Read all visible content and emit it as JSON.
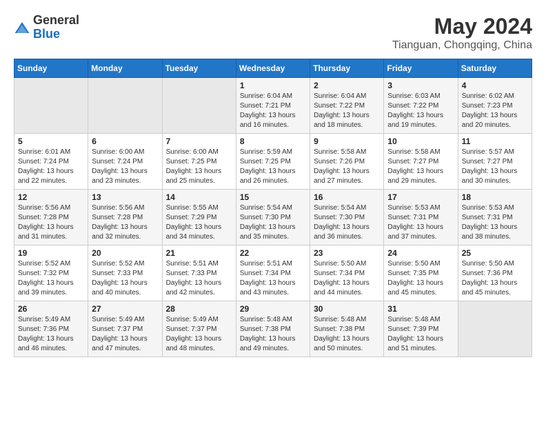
{
  "logo": {
    "general": "General",
    "blue": "Blue"
  },
  "header": {
    "title": "May 2024",
    "subtitle": "Tianguan, Chongqing, China"
  },
  "weekdays": [
    "Sunday",
    "Monday",
    "Tuesday",
    "Wednesday",
    "Thursday",
    "Friday",
    "Saturday"
  ],
  "weeks": [
    [
      {
        "day": "",
        "empty": true
      },
      {
        "day": "",
        "empty": true
      },
      {
        "day": "",
        "empty": true
      },
      {
        "day": "1",
        "sunrise": "6:04 AM",
        "sunset": "7:21 PM",
        "daylight": "13 hours and 16 minutes."
      },
      {
        "day": "2",
        "sunrise": "6:04 AM",
        "sunset": "7:22 PM",
        "daylight": "13 hours and 18 minutes."
      },
      {
        "day": "3",
        "sunrise": "6:03 AM",
        "sunset": "7:22 PM",
        "daylight": "13 hours and 19 minutes."
      },
      {
        "day": "4",
        "sunrise": "6:02 AM",
        "sunset": "7:23 PM",
        "daylight": "13 hours and 20 minutes."
      }
    ],
    [
      {
        "day": "5",
        "sunrise": "6:01 AM",
        "sunset": "7:24 PM",
        "daylight": "13 hours and 22 minutes."
      },
      {
        "day": "6",
        "sunrise": "6:00 AM",
        "sunset": "7:24 PM",
        "daylight": "13 hours and 23 minutes."
      },
      {
        "day": "7",
        "sunrise": "6:00 AM",
        "sunset": "7:25 PM",
        "daylight": "13 hours and 25 minutes."
      },
      {
        "day": "8",
        "sunrise": "5:59 AM",
        "sunset": "7:25 PM",
        "daylight": "13 hours and 26 minutes."
      },
      {
        "day": "9",
        "sunrise": "5:58 AM",
        "sunset": "7:26 PM",
        "daylight": "13 hours and 27 minutes."
      },
      {
        "day": "10",
        "sunrise": "5:58 AM",
        "sunset": "7:27 PM",
        "daylight": "13 hours and 29 minutes."
      },
      {
        "day": "11",
        "sunrise": "5:57 AM",
        "sunset": "7:27 PM",
        "daylight": "13 hours and 30 minutes."
      }
    ],
    [
      {
        "day": "12",
        "sunrise": "5:56 AM",
        "sunset": "7:28 PM",
        "daylight": "13 hours and 31 minutes."
      },
      {
        "day": "13",
        "sunrise": "5:56 AM",
        "sunset": "7:28 PM",
        "daylight": "13 hours and 32 minutes."
      },
      {
        "day": "14",
        "sunrise": "5:55 AM",
        "sunset": "7:29 PM",
        "daylight": "13 hours and 34 minutes."
      },
      {
        "day": "15",
        "sunrise": "5:54 AM",
        "sunset": "7:30 PM",
        "daylight": "13 hours and 35 minutes."
      },
      {
        "day": "16",
        "sunrise": "5:54 AM",
        "sunset": "7:30 PM",
        "daylight": "13 hours and 36 minutes."
      },
      {
        "day": "17",
        "sunrise": "5:53 AM",
        "sunset": "7:31 PM",
        "daylight": "13 hours and 37 minutes."
      },
      {
        "day": "18",
        "sunrise": "5:53 AM",
        "sunset": "7:31 PM",
        "daylight": "13 hours and 38 minutes."
      }
    ],
    [
      {
        "day": "19",
        "sunrise": "5:52 AM",
        "sunset": "7:32 PM",
        "daylight": "13 hours and 39 minutes."
      },
      {
        "day": "20",
        "sunrise": "5:52 AM",
        "sunset": "7:33 PM",
        "daylight": "13 hours and 40 minutes."
      },
      {
        "day": "21",
        "sunrise": "5:51 AM",
        "sunset": "7:33 PM",
        "daylight": "13 hours and 42 minutes."
      },
      {
        "day": "22",
        "sunrise": "5:51 AM",
        "sunset": "7:34 PM",
        "daylight": "13 hours and 43 minutes."
      },
      {
        "day": "23",
        "sunrise": "5:50 AM",
        "sunset": "7:34 PM",
        "daylight": "13 hours and 44 minutes."
      },
      {
        "day": "24",
        "sunrise": "5:50 AM",
        "sunset": "7:35 PM",
        "daylight": "13 hours and 45 minutes."
      },
      {
        "day": "25",
        "sunrise": "5:50 AM",
        "sunset": "7:36 PM",
        "daylight": "13 hours and 45 minutes."
      }
    ],
    [
      {
        "day": "26",
        "sunrise": "5:49 AM",
        "sunset": "7:36 PM",
        "daylight": "13 hours and 46 minutes."
      },
      {
        "day": "27",
        "sunrise": "5:49 AM",
        "sunset": "7:37 PM",
        "daylight": "13 hours and 47 minutes."
      },
      {
        "day": "28",
        "sunrise": "5:49 AM",
        "sunset": "7:37 PM",
        "daylight": "13 hours and 48 minutes."
      },
      {
        "day": "29",
        "sunrise": "5:48 AM",
        "sunset": "7:38 PM",
        "daylight": "13 hours and 49 minutes."
      },
      {
        "day": "30",
        "sunrise": "5:48 AM",
        "sunset": "7:38 PM",
        "daylight": "13 hours and 50 minutes."
      },
      {
        "day": "31",
        "sunrise": "5:48 AM",
        "sunset": "7:39 PM",
        "daylight": "13 hours and 51 minutes."
      },
      {
        "day": "",
        "empty": true
      }
    ]
  ],
  "labels": {
    "sunrise": "Sunrise:",
    "sunset": "Sunset:",
    "daylight": "Daylight:"
  }
}
